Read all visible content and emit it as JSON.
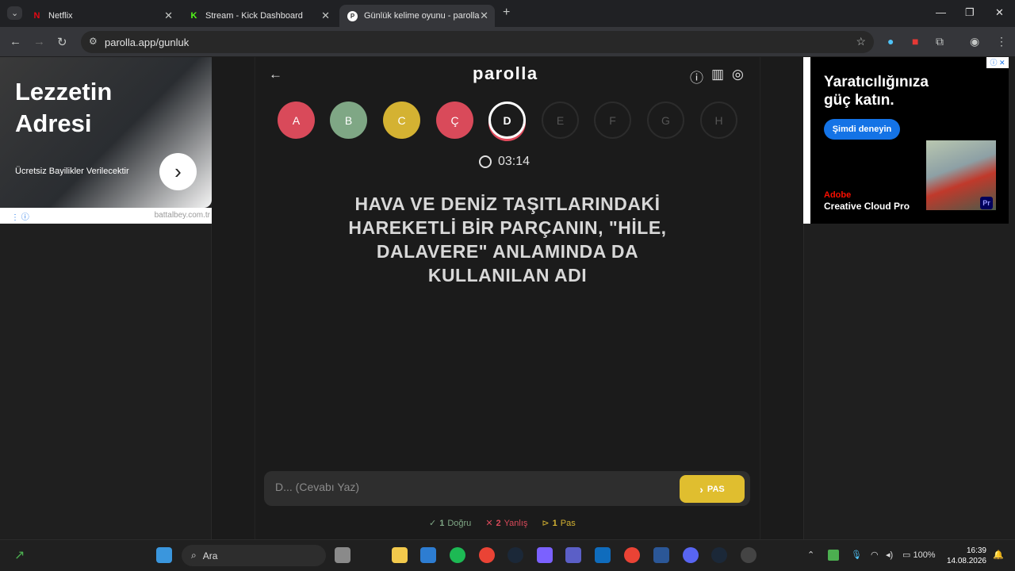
{
  "browser": {
    "tabs": [
      {
        "title": "Netflix",
        "active": false,
        "icon": "netflix-icon",
        "icon_color": "#e50914"
      },
      {
        "title": "Stream - Kick Dashboard",
        "active": false,
        "icon": "kick-icon",
        "icon_color": "#53fc18"
      },
      {
        "title": "Günlük kelime oyunu - parolla",
        "active": true,
        "icon": "parolla-icon",
        "icon_color": "#ffffff"
      }
    ],
    "url": "parolla.app/gunluk"
  },
  "ad_left": {
    "headline_line1": "Lezzetin",
    "headline_line2": "Adresi",
    "subtext": "Ücretsiz Bayilikler Verilecektir",
    "domain": "battalbey.com.tr"
  },
  "ad_right": {
    "headline_line1": "Yaratıcılığınıza",
    "headline_line2": "güç katın.",
    "cta": "Şimdi deneyin",
    "brand_line1": "Adobe",
    "brand_line2": "Creative Cloud Pro",
    "badge": "Pr"
  },
  "app": {
    "logo": "parolla",
    "letters": [
      {
        "label": "A",
        "state": "wrong",
        "color": "#d94a5a"
      },
      {
        "label": "B",
        "state": "correct",
        "color": "#7fa785"
      },
      {
        "label": "C",
        "state": "passed",
        "color": "#d4b232"
      },
      {
        "label": "Ç",
        "state": "wrong",
        "color": "#d94a5a"
      },
      {
        "label": "D",
        "state": "current",
        "color": "#1b1b1b"
      },
      {
        "label": "E",
        "state": "pending",
        "color": "#1b1b1b"
      },
      {
        "label": "F",
        "state": "pending",
        "color": "#1b1b1b"
      },
      {
        "label": "G",
        "state": "pending",
        "color": "#1b1b1b"
      },
      {
        "label": "H",
        "state": "pending",
        "color": "#1b1b1b"
      }
    ],
    "timer": "03:14",
    "question": "HAVA VE DENİZ TAŞITLARINDAKİ HAREKETLİ BİR PARÇANIN, \"HİLE, DALAVERE\" ANLAMINDA DA KULLANILAN ADI",
    "answer_placeholder": "D... (Cevabı Yaz)",
    "pass_label": "PAS",
    "stats": {
      "correct_count": "1",
      "correct_label": "Doğru",
      "correct_color": "#7fa785",
      "wrong_count": "2",
      "wrong_label": "Yanlış",
      "wrong_color": "#d94a5a",
      "pass_count": "1",
      "pass_label": "Pas",
      "pass_color": "#d4b232"
    }
  },
  "taskbar": {
    "search": "Ara",
    "battery": "100%",
    "time": "16:39",
    "date": "14.08.2026"
  }
}
